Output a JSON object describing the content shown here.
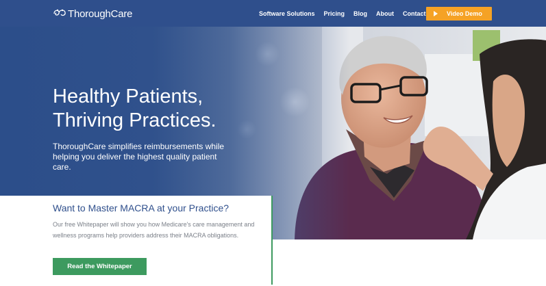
{
  "header": {
    "logo_text": "ThoroughCare",
    "nav": [
      {
        "label": "Software Solutions"
      },
      {
        "label": "Pricing"
      },
      {
        "label": "Blog"
      },
      {
        "label": "About"
      },
      {
        "label": "Contact Us"
      }
    ],
    "demo_button": "Video Demo",
    "background_color": "#2f4f8c",
    "demo_button_color": "#f5a225"
  },
  "hero": {
    "title_line1": "Healthy Patients,",
    "title_line2": "Thriving Practices.",
    "subtitle": "ThoroughCare simplifies reimbursements while helping you deliver the highest quality patient care."
  },
  "card": {
    "title": "Want to Master MACRA at your Practice?",
    "text": "Our free Whitepaper will show you how Medicare's care management and wellness programs help providers address their MACRA obligations.",
    "button": "Read the Whitepaper",
    "accent_color": "#3d9a5f"
  }
}
